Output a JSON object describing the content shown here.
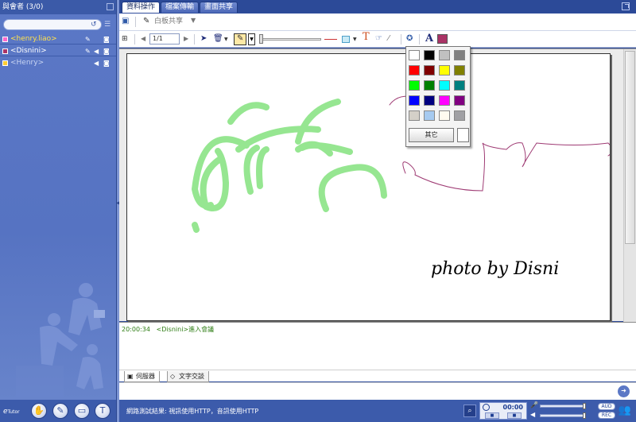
{
  "sidebar": {
    "title": "與會者 (3/0)",
    "search": {
      "value": "",
      "placeholder": ""
    },
    "members": [
      {
        "name": "<henry.liao>",
        "color": "#ff66cc"
      },
      {
        "name": "<Disnini>",
        "color": "#aa3366"
      },
      {
        "name": "<Henry>",
        "color": "#ffcc33"
      }
    ],
    "logo": "e",
    "logo_small": "Tutor"
  },
  "tabs": [
    {
      "label": "資料操作"
    },
    {
      "label": "檔案傳輸"
    },
    {
      "label": "畫面共享"
    }
  ],
  "toolbar": {
    "whiteboard_share": "白板共享",
    "page": "1/1",
    "text_color_glyph": "A",
    "current_color": "#aa3366"
  },
  "canvas": {
    "photo_credit": "photo by Disni"
  },
  "color_picker": {
    "colors": [
      "#ffffff",
      "#000000",
      "#c0c0c0",
      "#808080",
      "#ff0000",
      "#800000",
      "#ffff00",
      "#808000",
      "#00ff00",
      "#008000",
      "#00ffff",
      "#008080",
      "#0000ff",
      "#000080",
      "#ff00ff",
      "#800080",
      "#d4d0c8",
      "#a6caf0",
      "#fffbf0",
      "#a0a0a4"
    ],
    "more_label": "其它"
  },
  "chat": {
    "time": "20:00:34",
    "message": "<Disnini>進入會議",
    "tabs": [
      {
        "label": "伺服器"
      },
      {
        "label": "文字交談"
      }
    ],
    "input_value": ""
  },
  "status": {
    "text": "網路測試結果:  視訊使用HTTP，音訊使用HTTP",
    "rec_time": "00:00",
    "pill_top": "AUD",
    "pill_bottom": "REC"
  }
}
